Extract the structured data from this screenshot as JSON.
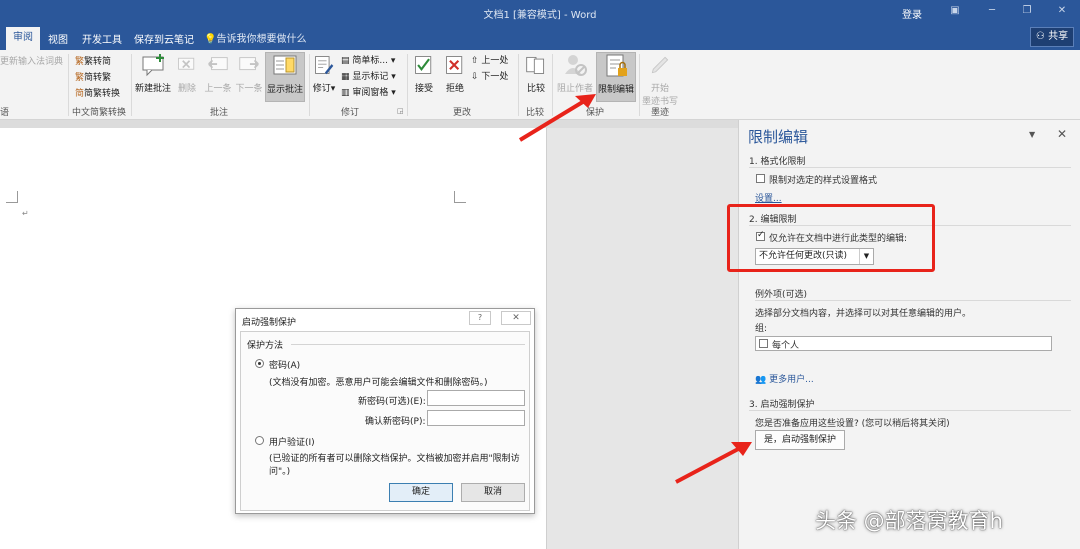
{
  "window": {
    "title": "文档1 [兼容模式] - Word",
    "login": "登录",
    "share": "共享"
  },
  "tabs": [
    "审阅",
    "视图",
    "开发工具",
    "保存到云笔记"
  ],
  "tellme": "告诉我你想要做什么",
  "ribbon": {
    "left_cut": "更新输入法词典",
    "s2t": "繁转简",
    "t2s": "简转繁",
    "convert": "简繁转换",
    "new_comment": "新建批注",
    "delete": "删除",
    "prev": "上一条",
    "next": "下一条",
    "show_comments": "显示批注",
    "track": "修订",
    "simple_markup": "简单标...",
    "show_markup": "显示标记",
    "review_pane": "审阅窗格",
    "accept": "接受",
    "reject": "拒绝",
    "prev_change": "上一处",
    "next_change": "下一处",
    "compare": "比较",
    "block_authors": "阻止作者",
    "restrict_editing": "限制编辑",
    "start_ink_1": "开始",
    "start_ink_2": "墨迹书写",
    "groups": {
      "g0": "语",
      "chinese": "中文简繁转换",
      "comments": "批注",
      "tracking": "修订",
      "changes": "更改",
      "compare": "比较",
      "protect": "保护",
      "ink": "墨迹"
    }
  },
  "dialog": {
    "title": "启动强制保护",
    "help": "?",
    "close": "✕",
    "section": "保护方法",
    "password": "密码(A)",
    "password_note": "(文档没有加密。恶意用户可能会编辑文件和删除密码。)",
    "new_password": "新密码(可选)(E):",
    "confirm_password": "确认新密码(P):",
    "user_auth": "用户验证(I)",
    "user_auth_note_1": "(已验证的所有者可以删除文档保护。文档被加密并启用\"限制访",
    "user_auth_note_2": "问\"。)",
    "ok": "确定",
    "cancel": "取消"
  },
  "pane": {
    "title": "限制编辑",
    "close": "✕",
    "sec1": "1. 格式化限制",
    "sec1_check": "限制对选定的样式设置格式",
    "sec1_link": "设置...",
    "sec2": "2. 编辑限制",
    "sec2_check": "仅允许在文档中进行此类型的编辑:",
    "sec2_select": "不允许任何更改(只读)",
    "exceptions": "例外项(可选)",
    "exceptions_desc": "选择部分文档内容，并选择可以对其任意编辑的用户。",
    "group": "组:",
    "everyone": "每个人",
    "more_users": "更多用户...",
    "sec3": "3. 启动强制保护",
    "sec3_q": "您是否准备应用这些设置? (您可以稍后将其关闭)",
    "sec3_btn": "是，启动强制保护"
  },
  "watermark": "头条 @部落窝教育h",
  "colors": {
    "accent": "#2b579a",
    "annotation": "#e8231a"
  }
}
